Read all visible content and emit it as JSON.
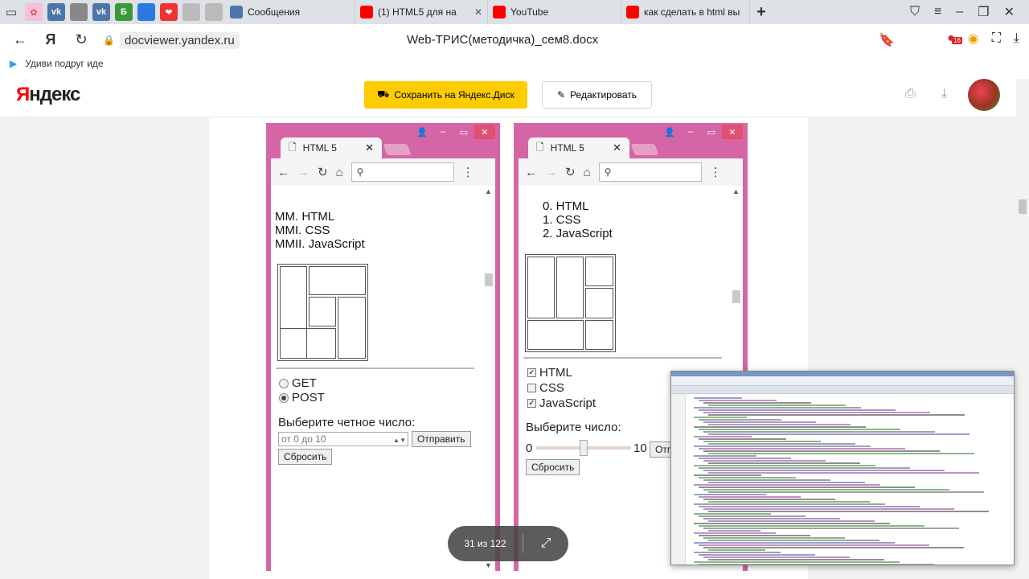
{
  "tabs": [
    {
      "label": "Сообщения",
      "color": "#4a76a8",
      "icon": "vk-messages-icon"
    },
    {
      "label": "(1) HTML5 для на",
      "color": "#ff0000",
      "icon": "youtube-icon"
    },
    {
      "label": "YouTube",
      "color": "#ff0000",
      "icon": "youtube-icon"
    },
    {
      "label": "как сделать в html вы",
      "color": "#ff0000",
      "icon": "yandex-icon"
    }
  ],
  "pinned_tabs": [
    {
      "icon": "vk-icon",
      "text": "vk",
      "color": "#4a76a8"
    },
    {
      "icon": "document-icon",
      "text": "",
      "color": "#888"
    },
    {
      "icon": "vk-icon",
      "text": "vk",
      "color": "#4a76a8"
    },
    {
      "icon": "b-icon",
      "text": "Б",
      "color": "#3a9a3a"
    },
    {
      "icon": "document-icon",
      "text": "",
      "color": "#2a7ae2"
    },
    {
      "icon": "heart-icon",
      "text": "❤",
      "color": "#e33"
    },
    {
      "icon": "document-icon",
      "text": "",
      "color": "#bbb"
    },
    {
      "icon": "document-icon",
      "text": "",
      "color": "#bbb"
    }
  ],
  "address": {
    "domain": "docviewer.yandex.ru",
    "title": "Web-ТРИС(методичка)_сем8.docx",
    "badge": "16"
  },
  "bookmarks": {
    "item": "Удиви подруг иде"
  },
  "yandex": {
    "logo_first": "Я",
    "logo_rest": "ндекс",
    "save_label": "Сохранить на Яндекс.Диск",
    "edit_label": "Редактировать"
  },
  "doc": {
    "left_mock": {
      "tab_title": "HTML 5",
      "list": [
        "MM. HTML",
        "MMI. CSS",
        "MMII. JavaScript"
      ],
      "radios": [
        {
          "label": "GET",
          "checked": false
        },
        {
          "label": "POST",
          "checked": true
        }
      ],
      "number_label": "Выберите четное число:",
      "number_placeholder": "от 0 до 10",
      "submit_label": "Отправить",
      "reset_label": "Сбросить"
    },
    "right_mock": {
      "tab_title": "HTML 5",
      "list": [
        "0. HTML",
        "1. CSS",
        "2. JavaScript"
      ],
      "checkboxes": [
        {
          "label": "HTML",
          "checked": true
        },
        {
          "label": "CSS",
          "checked": false
        },
        {
          "label": "JavaScript",
          "checked": true
        }
      ],
      "range_label": "Выберите число:",
      "range_min": "0",
      "range_max": "10",
      "submit_label": "Отп",
      "reset_label": "Сбросить"
    }
  },
  "pager": {
    "count": "31 из 122"
  },
  "colors": {
    "mock_frame": "#d466a6",
    "yandex_yellow": "#ffcc00",
    "yandex_red": "#ff0000"
  }
}
